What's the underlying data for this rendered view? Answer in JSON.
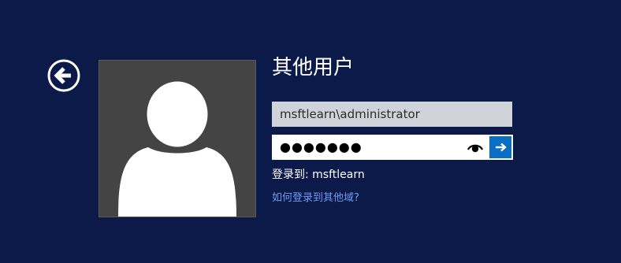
{
  "icons": {
    "back": "back-arrow-icon",
    "avatar": "user-silhouette-icon",
    "reveal": "eye-icon",
    "submit": "arrow-right-icon"
  },
  "colors": {
    "background": "#0b1a49",
    "avatar_bg": "#444444",
    "username_field_bg": "#d0d3da",
    "submit_button": "#0a6fc2",
    "link": "#6f9cf3"
  },
  "login": {
    "title": "其他用户",
    "username_value": "msftlearn\\administrator",
    "password_mask": "●●●●●●●",
    "signin_to": "登录到: msftlearn",
    "other_domain_link": "如何登录到其他域?"
  }
}
